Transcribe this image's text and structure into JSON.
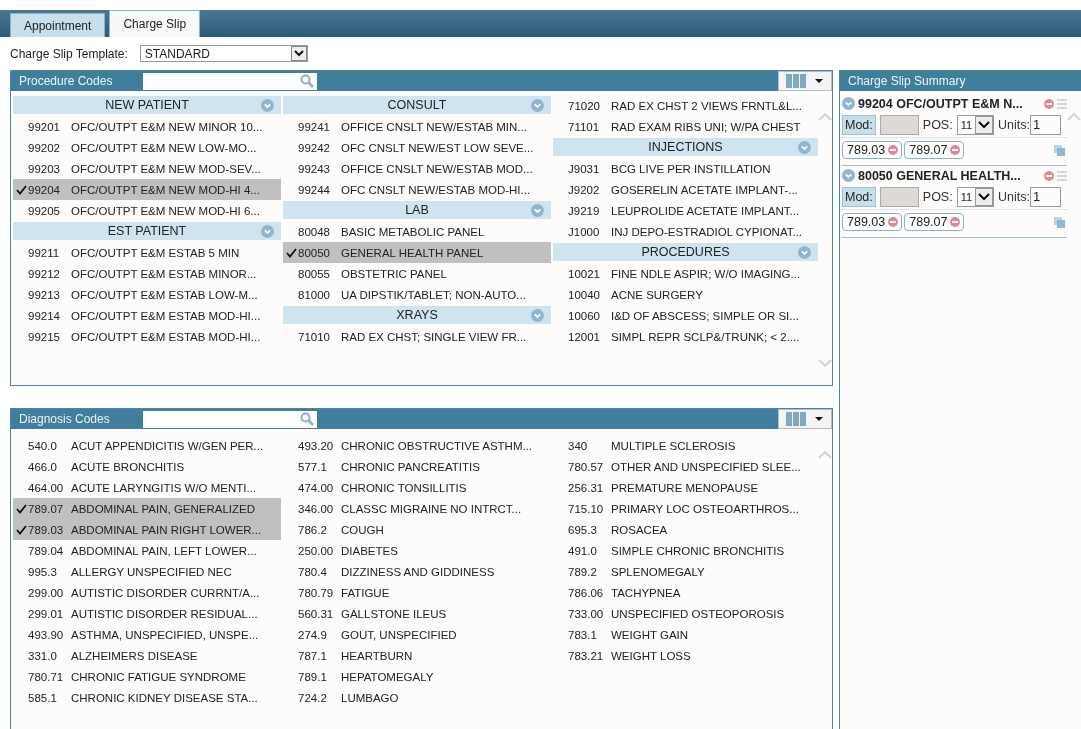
{
  "tabs": [
    {
      "label": "Appointment",
      "selected": false
    },
    {
      "label": "Charge Slip",
      "selected": true
    }
  ],
  "template": {
    "label": "Charge Slip Template:",
    "value": "STANDARD"
  },
  "procedure_codes": {
    "title": "Procedure Codes",
    "columns": [
      [
        {
          "kind": "header",
          "label": "NEW PATIENT",
          "expanded": true
        },
        {
          "kind": "code",
          "code": "99201",
          "description": "OFC/OUTPT E&M NEW MINOR 10...",
          "selected": false
        },
        {
          "kind": "code",
          "code": "99202",
          "description": "OFC/OUTPT E&M NEW LOW-MO...",
          "selected": false
        },
        {
          "kind": "code",
          "code": "99203",
          "description": "OFC/OUTPT E&M NEW MOD-SEV...",
          "selected": false
        },
        {
          "kind": "code",
          "code": "99204",
          "description": "OFC/OUTPT E&M NEW MOD-HI 4...",
          "selected": true
        },
        {
          "kind": "code",
          "code": "99205",
          "description": "OFC/OUTPT E&M NEW MOD-HI 6...",
          "selected": false
        },
        {
          "kind": "header",
          "label": "EST PATIENT",
          "expanded": true
        },
        {
          "kind": "code",
          "code": "99211",
          "description": "OFC/OUTPT E&M ESTAB 5 MIN",
          "selected": false
        },
        {
          "kind": "code",
          "code": "99212",
          "description": "OFC/OUTPT E&M ESTAB MINOR...",
          "selected": false
        },
        {
          "kind": "code",
          "code": "99213",
          "description": "OFC/OUTPT E&M ESTAB LOW-M...",
          "selected": false
        },
        {
          "kind": "code",
          "code": "99214",
          "description": "OFC/OUTPT E&M ESTAB MOD-HI...",
          "selected": false
        },
        {
          "kind": "code",
          "code": "99215",
          "description": "OFC/OUTPT E&M ESTAB MOD-HI...",
          "selected": false
        }
      ],
      [
        {
          "kind": "header",
          "label": "CONSULT",
          "expanded": true
        },
        {
          "kind": "code",
          "code": "99241",
          "description": "OFFICE CNSLT NEW/ESTAB MIN...",
          "selected": false
        },
        {
          "kind": "code",
          "code": "99242",
          "description": "OFC CNSLT NEW/EST LOW SEVE...",
          "selected": false
        },
        {
          "kind": "code",
          "code": "99243",
          "description": "OFFICE CNSLT NEW/ESTAB MOD...",
          "selected": false
        },
        {
          "kind": "code",
          "code": "99244",
          "description": "OFC CNSLT NEW/ESTAB MOD-HI...",
          "selected": false
        },
        {
          "kind": "header",
          "label": "LAB",
          "expanded": true
        },
        {
          "kind": "code",
          "code": "80048",
          "description": "BASIC METABOLIC PANEL",
          "selected": false
        },
        {
          "kind": "code",
          "code": "80050",
          "description": "GENERAL HEALTH PANEL",
          "selected": true
        },
        {
          "kind": "code",
          "code": "80055",
          "description": "OBSTETRIC PANEL",
          "selected": false
        },
        {
          "kind": "code",
          "code": "81000",
          "description": "UA DIPSTIK/TABLET; NON-AUTO...",
          "selected": false
        },
        {
          "kind": "header",
          "label": "XRAYS",
          "expanded": true
        },
        {
          "kind": "code",
          "code": "71010",
          "description": "RAD EX CHST; SINGLE VIEW FR...",
          "selected": false
        }
      ],
      [
        {
          "kind": "code",
          "code": "71020",
          "description": "RAD EX CHST 2 VIEWS FRNTL&L...",
          "selected": false
        },
        {
          "kind": "code",
          "code": "71101",
          "description": "RAD EXAM RIBS UNI; W/PA CHEST",
          "selected": false
        },
        {
          "kind": "header",
          "label": "INJECTIONS",
          "expanded": true
        },
        {
          "kind": "code",
          "code": "J9031",
          "description": "BCG LIVE PER INSTILLATION",
          "selected": false
        },
        {
          "kind": "code",
          "code": "J9202",
          "description": "GOSERELIN ACETATE IMPLANT-...",
          "selected": false
        },
        {
          "kind": "code",
          "code": "J9219",
          "description": "LEUPROLIDE ACETATE IMPLANT...",
          "selected": false
        },
        {
          "kind": "code",
          "code": "J1000",
          "description": "INJ DEPO-ESTRADIOL CYPIONAT...",
          "selected": false
        },
        {
          "kind": "header",
          "label": "PROCEDURES",
          "expanded": true
        },
        {
          "kind": "code",
          "code": "10021",
          "description": "FINE NDLE ASPIR; W/O IMAGING...",
          "selected": false
        },
        {
          "kind": "code",
          "code": "10040",
          "description": "ACNE SURGERY",
          "selected": false
        },
        {
          "kind": "code",
          "code": "10060",
          "description": "I&D OF ABSCESS; SIMPLE OR SI...",
          "selected": false
        },
        {
          "kind": "code",
          "code": "12001",
          "description": "SIMPL REPR SCLP&/TRUNK; < 2....",
          "selected": false
        }
      ]
    ]
  },
  "diagnosis_codes": {
    "title": "Diagnosis Codes",
    "columns": [
      [
        {
          "kind": "code",
          "code": "540.0",
          "description": "ACUT APPENDICITIS W/GEN PER...",
          "selected": false
        },
        {
          "kind": "code",
          "code": "466.0",
          "description": "ACUTE BRONCHITIS",
          "selected": false
        },
        {
          "kind": "code",
          "code": "464.00",
          "description": "ACUTE LARYNGITIS W/O MENTI...",
          "selected": false
        },
        {
          "kind": "code",
          "code": "789.07",
          "description": "ABDOMINAL PAIN, GENERALIZED",
          "selected": true
        },
        {
          "kind": "code",
          "code": "789.03",
          "description": "ABDOMINAL PAIN RIGHT LOWER...",
          "selected": true
        },
        {
          "kind": "code",
          "code": "789.04",
          "description": "ABDOMINAL PAIN, LEFT LOWER...",
          "selected": false
        },
        {
          "kind": "code",
          "code": "995.3",
          "description": "ALLERGY UNSPECIFIED NEC",
          "selected": false
        },
        {
          "kind": "code",
          "code": "299.00",
          "description": "AUTISTIC DISORDER CURRNT/A...",
          "selected": false
        },
        {
          "kind": "code",
          "code": "299.01",
          "description": "AUTISTIC DISORDER RESIDUAL...",
          "selected": false
        },
        {
          "kind": "code",
          "code": "493.90",
          "description": "ASTHMA, UNSPECIFIED, UNSPE...",
          "selected": false
        },
        {
          "kind": "code",
          "code": "331.0",
          "description": "ALZHEIMERS DISEASE",
          "selected": false
        },
        {
          "kind": "code",
          "code": "780.71",
          "description": "CHRONIC FATIGUE SYNDROME",
          "selected": false
        },
        {
          "kind": "code",
          "code": "585.1",
          "description": "CHRONIC KIDNEY DISEASE STA...",
          "selected": false
        }
      ],
      [
        {
          "kind": "code",
          "code": "493.20",
          "description": "CHRONIC OBSTRUCTIVE ASTHM...",
          "selected": false
        },
        {
          "kind": "code",
          "code": "577.1",
          "description": "CHRONIC PANCREATITIS",
          "selected": false
        },
        {
          "kind": "code",
          "code": "474.00",
          "description": "CHRONIC TONSILLITIS",
          "selected": false
        },
        {
          "kind": "code",
          "code": "346.00",
          "description": "CLASSC MIGRAINE NO INTRCT...",
          "selected": false
        },
        {
          "kind": "code",
          "code": "786.2",
          "description": "COUGH",
          "selected": false
        },
        {
          "kind": "code",
          "code": "250.00",
          "description": "DIABETES",
          "selected": false
        },
        {
          "kind": "code",
          "code": "780.4",
          "description": "DIZZINESS AND GIDDINESS",
          "selected": false
        },
        {
          "kind": "code",
          "code": "780.79",
          "description": "FATIGUE",
          "selected": false
        },
        {
          "kind": "code",
          "code": "560.31",
          "description": "GALLSTONE ILEUS",
          "selected": false
        },
        {
          "kind": "code",
          "code": "274.9",
          "description": "GOUT, UNSPECIFIED",
          "selected": false
        },
        {
          "kind": "code",
          "code": "787.1",
          "description": "HEARTBURN",
          "selected": false
        },
        {
          "kind": "code",
          "code": "789.1",
          "description": "HEPATOMEGALY",
          "selected": false
        },
        {
          "kind": "code",
          "code": "724.2",
          "description": "LUMBAGO",
          "selected": false
        }
      ],
      [
        {
          "kind": "code",
          "code": "340",
          "description": "MULTIPLE SCLEROSIS",
          "selected": false
        },
        {
          "kind": "code",
          "code": "780.57",
          "description": "OTHER AND UNSPECIFIED SLEE...",
          "selected": false
        },
        {
          "kind": "code",
          "code": "256.31",
          "description": "PREMATURE MENOPAUSE",
          "selected": false
        },
        {
          "kind": "code",
          "code": "715.10",
          "description": "PRIMARY LOC OSTEOARTHROS...",
          "selected": false
        },
        {
          "kind": "code",
          "code": "695.3",
          "description": "ROSACEA",
          "selected": false
        },
        {
          "kind": "code",
          "code": "491.0",
          "description": "SIMPLE CHRONIC BRONCHITIS",
          "selected": false
        },
        {
          "kind": "code",
          "code": "789.2",
          "description": "SPLENOMEGALY",
          "selected": false
        },
        {
          "kind": "code",
          "code": "786.06",
          "description": "TACHYPNEA",
          "selected": false
        },
        {
          "kind": "code",
          "code": "733.00",
          "description": "UNSPECIFIED OSTEOPOROSIS",
          "selected": false
        },
        {
          "kind": "code",
          "code": "783.1",
          "description": "WEIGHT GAIN",
          "selected": false
        },
        {
          "kind": "code",
          "code": "783.21",
          "description": "WEIGHT LOSS",
          "selected": false
        }
      ]
    ]
  },
  "summary": {
    "title": "Charge Slip Summary",
    "charges": [
      {
        "title": "99204 OFC/OUTPT E&M N...",
        "mod_label": "Mod:",
        "pos_label": "POS:",
        "pos_value": "11",
        "units_label": "Units:",
        "units_value": "1",
        "diagnoses": [
          "789.03",
          "789.07"
        ]
      },
      {
        "title": "80050 GENERAL HEALTH...",
        "mod_label": "Mod:",
        "pos_label": "POS:",
        "pos_value": "11",
        "units_label": "Units:",
        "units_value": "1",
        "diagnoses": [
          "789.03",
          "789.07"
        ]
      }
    ]
  }
}
